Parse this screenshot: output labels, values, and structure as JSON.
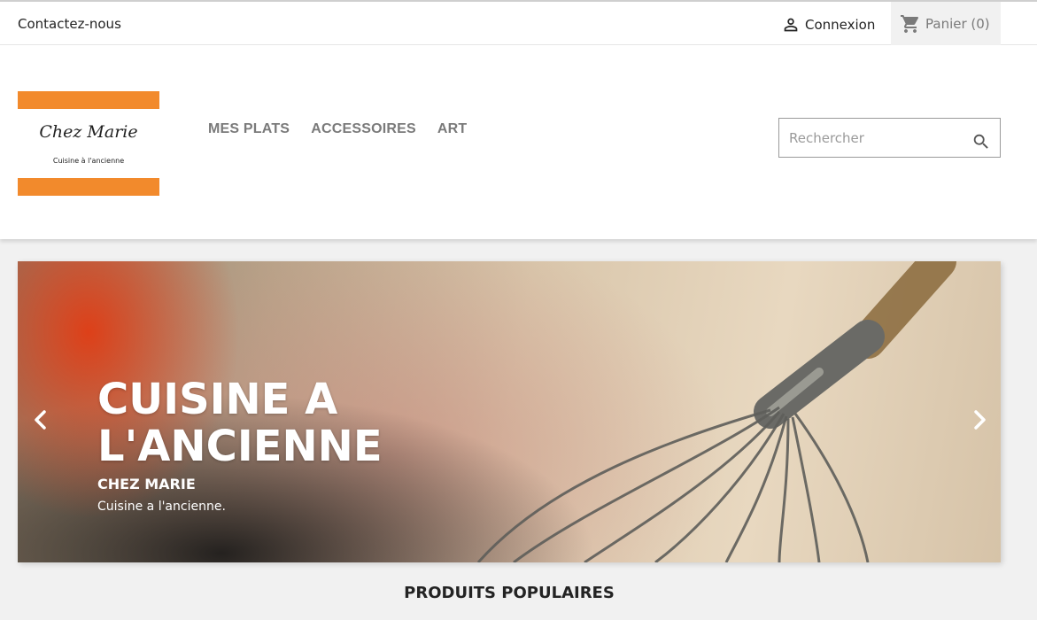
{
  "topbar": {
    "contact": "Contactez-nous",
    "login": "Connexion",
    "cart": "Panier (0)"
  },
  "logo": {
    "name": "Chez Marie",
    "tagline": "Cuisine à l'ancienne",
    "color": "#f28a2c"
  },
  "nav": {
    "items": [
      "MES PLATS",
      "ACCESSOIRES",
      "ART"
    ]
  },
  "search": {
    "placeholder": "Rechercher",
    "icon": "search-icon"
  },
  "slider": {
    "title": "CUISINE A L'ANCIENNE",
    "subtitle": "CHEZ MARIE",
    "text": "Cuisine a l'ancienne."
  },
  "section": {
    "title": "PRODUITS POPULAIRES"
  }
}
